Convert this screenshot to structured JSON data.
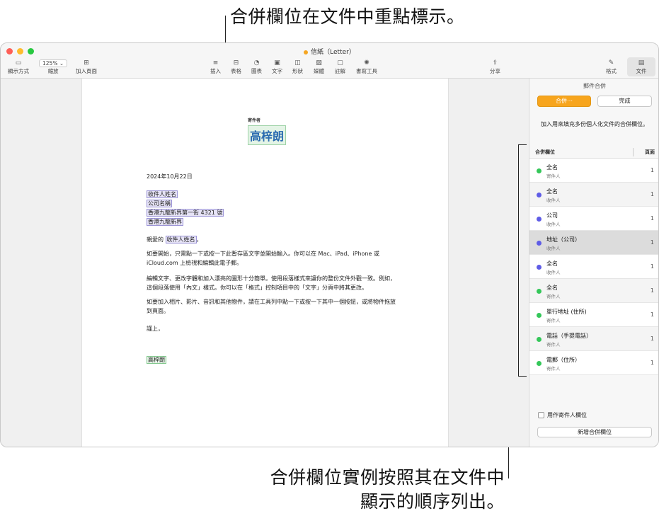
{
  "callouts": {
    "top": "合併欄位在文件中重點標示。",
    "bottom_line1": "合併欄位實例按照其在文件中",
    "bottom_line2": "顯示的順序列出。"
  },
  "window": {
    "title": "信紙（Letter）",
    "toolbar": {
      "view": "顯示方式",
      "zoom_value": "125%",
      "zoom": "縮放",
      "add_page": "加入頁面",
      "insert": "插入",
      "table": "表格",
      "chart": "圖表",
      "text": "文字",
      "shape": "形狀",
      "media": "媒體",
      "comment": "註解",
      "writing_tools": "書寫工具",
      "share": "分享",
      "format": "格式",
      "document": "文件"
    }
  },
  "document": {
    "sender_label": "寄件者",
    "sender_name": "高梓朗",
    "date": "2024年10月22日",
    "recipient_name": "收件人姓名",
    "company": "公司名稱",
    "address1": "香港九龍新界第一街 4321 號",
    "address2": "香港九龍新界",
    "salutation_prefix": "親愛的",
    "salutation_field": "收件人姓名",
    "salutation_suffix": "，",
    "para1_line1": "如要開始，只需點一下或按一下此暫存區文字並開始輸入。你可以在 Mac、iPad、iPhone 或",
    "para1_line2": "iCloud.com 上檢視和編輯此電子郵。",
    "para2_line1": "編輯文字、更改字體和加入漂亮的圖形十分簡單。使用段落樣式來讓你的整份文件外觀一致。例如，",
    "para2_line2": "這個段落使用「內文」樣式。你可以在「格式」控制項目中的「文字」分頁中將其更改。",
    "para3_line1": "如要加入相片、影片、音訊和其他物件，請在工具列中點一下或按一下其中一個按鈕，或將物件拖放",
    "para3_line2": "到頁面。",
    "closing": "謹上，",
    "signature": "高梓朗"
  },
  "sidebar": {
    "title": "郵件合併",
    "merge_button": "合併⋯",
    "done_button": "完成",
    "description": "加入用來填充多份個人化文件的合併欄位。",
    "col_field": "合併欄位",
    "col_page": "頁面",
    "fields": [
      {
        "name": "全名",
        "source": "寄件人",
        "page": "1",
        "color": "#34c759"
      },
      {
        "name": "全名",
        "source": "收件人",
        "page": "1",
        "color": "#5e5ce6"
      },
      {
        "name": "公司",
        "source": "收件人",
        "page": "1",
        "color": "#5e5ce6"
      },
      {
        "name": "地址（公司）",
        "source": "收件人",
        "page": "1",
        "color": "#5e5ce6"
      },
      {
        "name": "全名",
        "source": "收件人",
        "page": "1",
        "color": "#5e5ce6"
      },
      {
        "name": "全名",
        "source": "寄件人",
        "page": "1",
        "color": "#34c759"
      },
      {
        "name": "單行地址 (住所)",
        "source": "寄件人",
        "page": "1",
        "color": "#34c759"
      },
      {
        "name": "電話（手提電話）",
        "source": "寄件人",
        "page": "1",
        "color": "#34c759"
      },
      {
        "name": "電郵（住所）",
        "source": "寄件人",
        "page": "1",
        "color": "#34c759"
      }
    ],
    "use_sender_label": "用作寄件人欄位",
    "add_field_button": "新增合併欄位"
  }
}
